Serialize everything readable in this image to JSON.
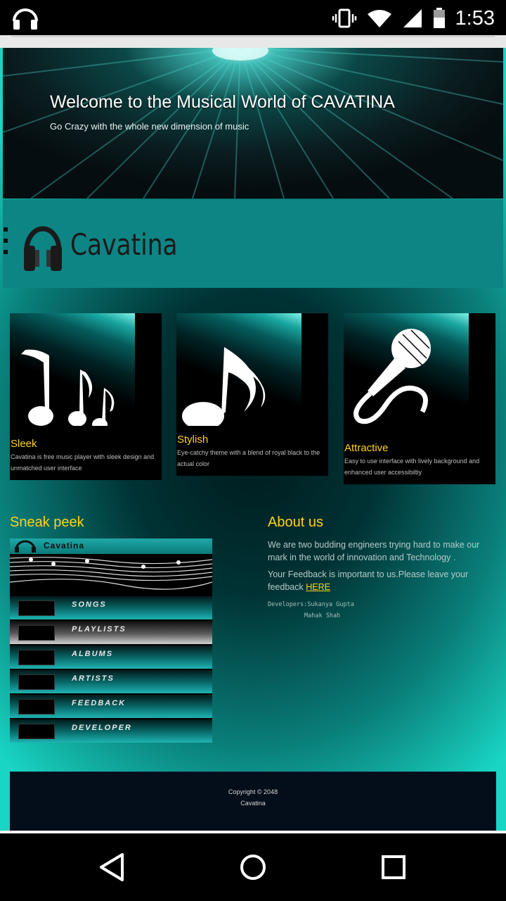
{
  "status_bar": {
    "time": "1:53",
    "icons": [
      "headphones-icon",
      "vibrate-icon",
      "wifi-icon",
      "signal-icon",
      "battery-icon"
    ]
  },
  "hero": {
    "title": "Welcome to the Musical World of CAVATINA",
    "subtitle": "Go Crazy with the whole new dimension of music"
  },
  "logo": {
    "text": "Cavatina"
  },
  "features": [
    {
      "title": "Sleek",
      "description": "Cavatina is free music player with sleek design and unmatched user interface",
      "icon": "music-notes-icon"
    },
    {
      "title": "Stylish",
      "description": "Eye-catchy theme with a blend of royal black to the actual color",
      "icon": "music-note-icon"
    },
    {
      "title": "Attractive",
      "description": "Easy to use interface with lively background and enhanced user accessibiltiy",
      "icon": "microphone-icon"
    }
  ],
  "sneak_peek": {
    "title": "Sneak peek",
    "app_title": "Cavatina",
    "menu": [
      "SONGS",
      "PLAYLISTS",
      "ALBUMS",
      "ARTISTS",
      "FEEDBACK",
      "DEVELOPER"
    ]
  },
  "about": {
    "title": "About us",
    "p1": "We are two budding engineers trying hard to make our mark in the world of innovation and Technology .",
    "p2_prefix": "Your Feedback is important to us.Please leave your feedback ",
    "p2_link": "HERE",
    "dev_line1": "Developers:Sukanya Gupta",
    "dev_line2": "Mahak Shah"
  },
  "footer": {
    "copyright": "Copyright © 2048",
    "name": "Cavatina"
  },
  "colors": {
    "accent": "#ffd21a",
    "teal": "#0d8585",
    "footer_bg": "#040d1a"
  }
}
